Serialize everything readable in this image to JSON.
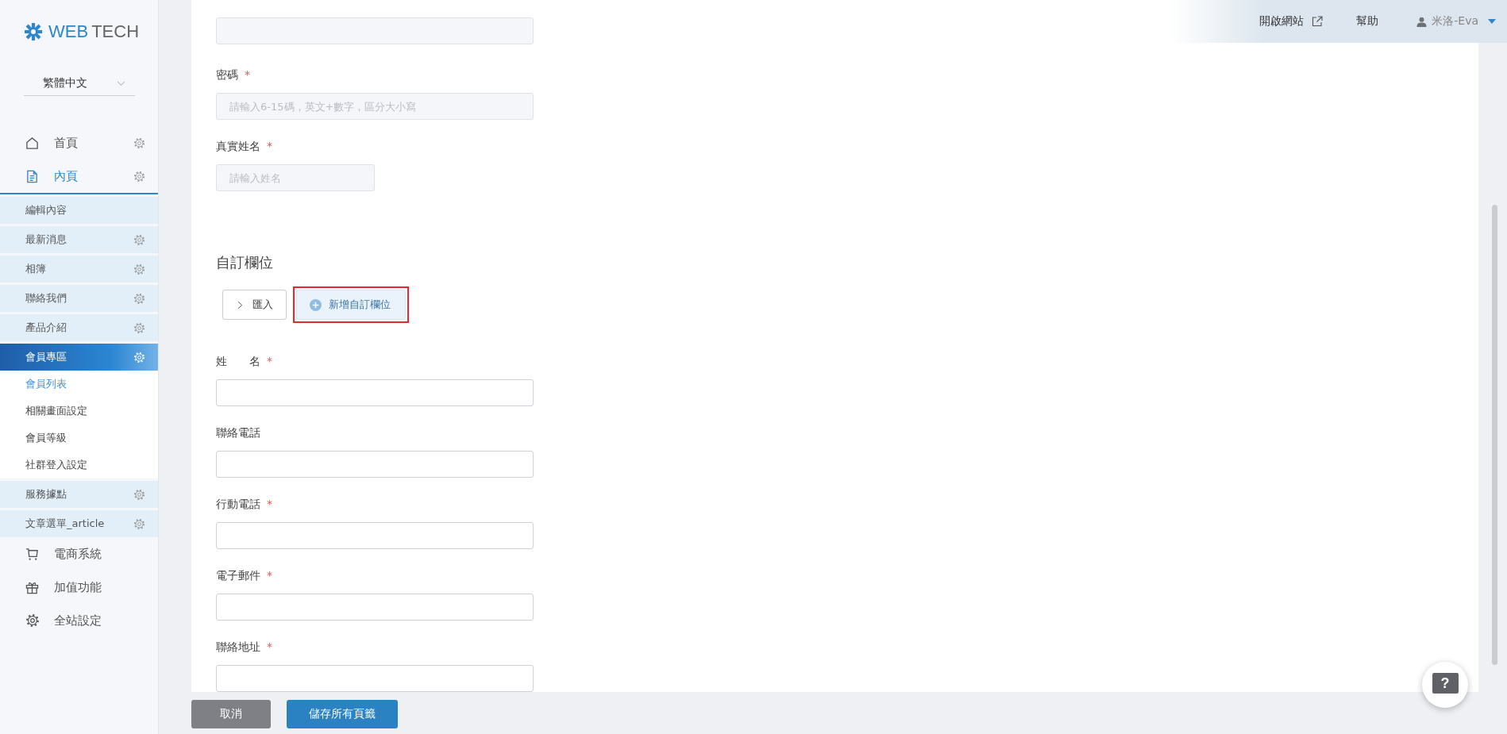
{
  "sidebar": {
    "logo": {
      "primary": "WEB",
      "secondary": "TECH"
    },
    "language": "繁體中文",
    "nav": [
      {
        "label": "首頁",
        "selected": false,
        "settings_icon": true
      },
      {
        "label": "內頁",
        "selected": true,
        "settings_icon": true,
        "children": [
          {
            "label": "編輯內容",
            "selected": false,
            "settings_icon": false
          },
          {
            "label": "最新消息",
            "selected": false,
            "settings_icon": true
          },
          {
            "label": "相簿",
            "selected": false,
            "settings_icon": true
          },
          {
            "label": "聯絡我們",
            "selected": false,
            "settings_icon": true
          },
          {
            "label": "產品介紹",
            "selected": false,
            "settings_icon": true
          },
          {
            "label": "會員專區",
            "selected": true,
            "settings_icon": true,
            "children": [
              {
                "label": "會員列表",
                "selected": true
              },
              {
                "label": "相關畫面設定",
                "selected": false
              },
              {
                "label": "會員等級",
                "selected": false
              },
              {
                "label": "社群登入設定",
                "selected": false
              }
            ]
          },
          {
            "label": "服務據點",
            "selected": false,
            "settings_icon": true
          },
          {
            "label": "文章選單_article",
            "selected": false,
            "settings_icon": true
          }
        ]
      },
      {
        "label": "電商系統",
        "selected": false,
        "settings_icon": false
      },
      {
        "label": "加值功能",
        "selected": false,
        "settings_icon": false
      },
      {
        "label": "全站設定",
        "selected": false,
        "settings_icon": false
      }
    ]
  },
  "top_bar": {
    "open_site": "開啟網站",
    "help": "幫助",
    "user": "米洛-Eva"
  },
  "account_fields": [
    {
      "disabled": true
    },
    {
      "label": "密碼",
      "required_mark": "*",
      "placeholder": "請輸入6-15碼，英文+數字，區分大小寫",
      "disabled": true
    },
    {
      "label": "真實姓名",
      "required_mark": "*",
      "placeholder": "請輸入姓名",
      "disabled": true,
      "kind": "short"
    }
  ],
  "custom_section": {
    "title": "自訂欄位",
    "buttons": [
      {
        "label": "匯入",
        "kind": "import",
        "highlighted": false
      },
      {
        "label": "新增自訂欄位",
        "kind": "add",
        "highlighted": true
      }
    ],
    "fields": [
      {
        "label": "姓　　名",
        "required_mark": "*",
        "disabled": false
      },
      {
        "label": "聯絡電話",
        "disabled": false
      },
      {
        "label": "行動電話",
        "required_mark": "*",
        "disabled": false
      },
      {
        "label": "電子郵件",
        "required_mark": "*",
        "disabled": false
      },
      {
        "label": "聯絡地址",
        "required_mark": "*",
        "disabled": false
      }
    ]
  },
  "footer_buttons": [
    {
      "label": "取消",
      "kind": "cancel"
    },
    {
      "label": "儲存所有頁籤",
      "kind": "save"
    }
  ],
  "help_button": {
    "glyph": "?"
  }
}
